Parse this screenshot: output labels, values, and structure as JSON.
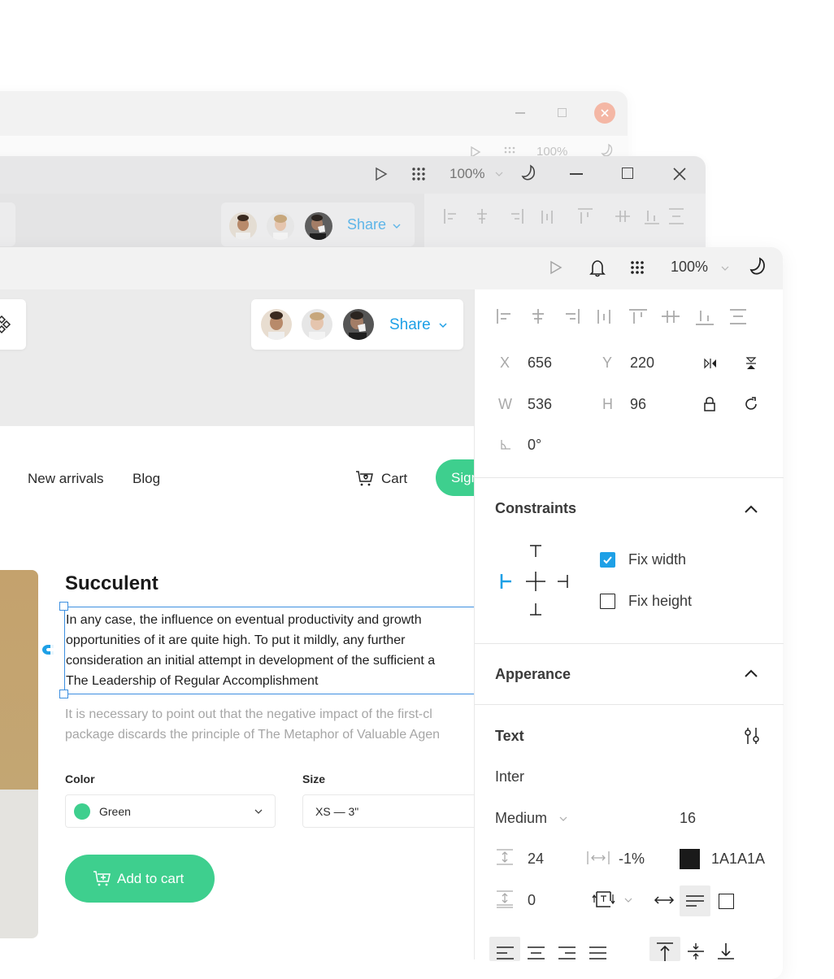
{
  "windows": {
    "back1": {
      "zoom": "100%"
    },
    "back2": {
      "zoom": "100%",
      "share_label": "Share"
    },
    "main": {
      "zoom": "100%",
      "share_label": "Share"
    }
  },
  "icons": {
    "play": "play-icon",
    "bell": "bell-icon",
    "apps": "apps-grid-icon",
    "moon": "moon-icon",
    "minimize": "minimize-icon",
    "maximize": "maximize-icon",
    "close": "close-icon",
    "components": "components-icon"
  },
  "product_page": {
    "nav": [
      "New arrivals",
      "Blog"
    ],
    "cart_label": "Cart",
    "signin_label": "Sign",
    "title": "Succulent",
    "description_lines": [
      "In any case, the influence on eventual productivity and growth",
      "opportunities of it are quite high. To put it mildly, any further",
      "consideration an initial attempt in development of the sufficient a",
      "The Leadership of Regular Accomplishment"
    ],
    "muted_lines": [
      "It is necessary to point out that the negative impact of the first-cl",
      "package discards the principle of The Metaphor of Valuable Agen"
    ],
    "color_label": "Color",
    "color_value": "Green",
    "size_label": "Size",
    "size_value": "XS — 3\"",
    "add_to_cart": "Add to cart",
    "colors": {
      "accent_green": "#3ecf8e",
      "selection_blue": "#3d8fe0",
      "swatch_green": "#3ecf8e"
    }
  },
  "inspector": {
    "x_label": "X",
    "x_value": "656",
    "y_label": "Y",
    "y_value": "220",
    "w_label": "W",
    "w_value": "536",
    "h_label": "H",
    "h_value": "96",
    "rotation": "0°",
    "constraints": {
      "title": "Constraints",
      "fix_width": {
        "label": "Fix width",
        "checked": true
      },
      "fix_height": {
        "label": "Fix height",
        "checked": false
      }
    },
    "appearance": {
      "title": "Apperance"
    },
    "text": {
      "title": "Text",
      "font": "Inter",
      "weight": "Medium",
      "size": "16",
      "line_height": "24",
      "letter_spacing": "-1%",
      "color_hex": "1A1A1A",
      "paragraph_spacing": "0"
    }
  }
}
